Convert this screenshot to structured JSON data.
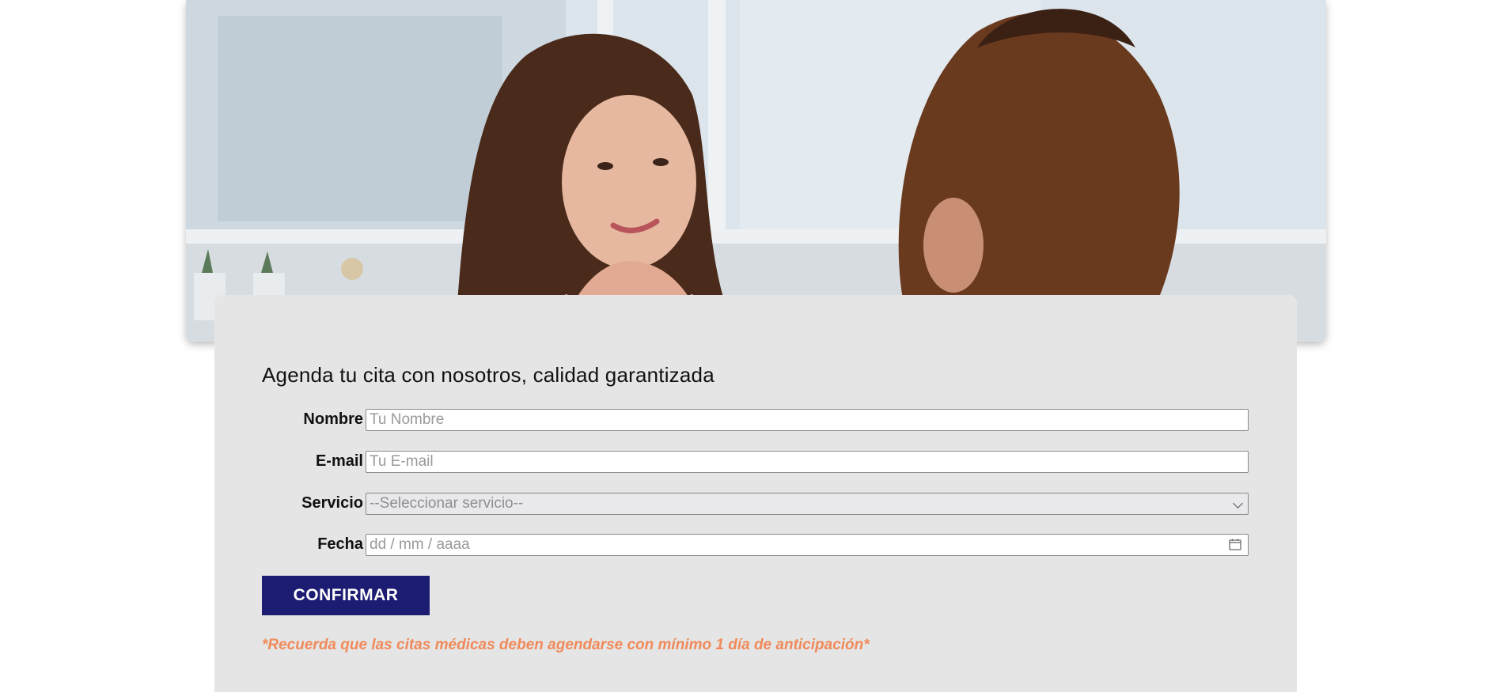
{
  "hero": {
    "image_description_icon": "doctor-consultation-photo"
  },
  "form": {
    "heading": "Agenda tu cita con nosotros, calidad garantizada",
    "fields": {
      "nombre": {
        "label": "Nombre",
        "placeholder": "Tu Nombre"
      },
      "email": {
        "label": "E-mail",
        "placeholder": "Tu E-mail"
      },
      "servicio": {
        "label": "Servicio",
        "selected": "--Seleccionar servicio--"
      },
      "fecha": {
        "label": "Fecha",
        "placeholder": "dd / mm / aaaa"
      }
    },
    "confirm_label": "CONFIRMAR",
    "note": "*Recuerda que las citas médicas deben agendarse con mínimo 1 día de anticipación*"
  },
  "colors": {
    "panel_bg": "#e5e5e5",
    "button_bg": "#1c1c72",
    "note_color": "#f08a5a"
  }
}
